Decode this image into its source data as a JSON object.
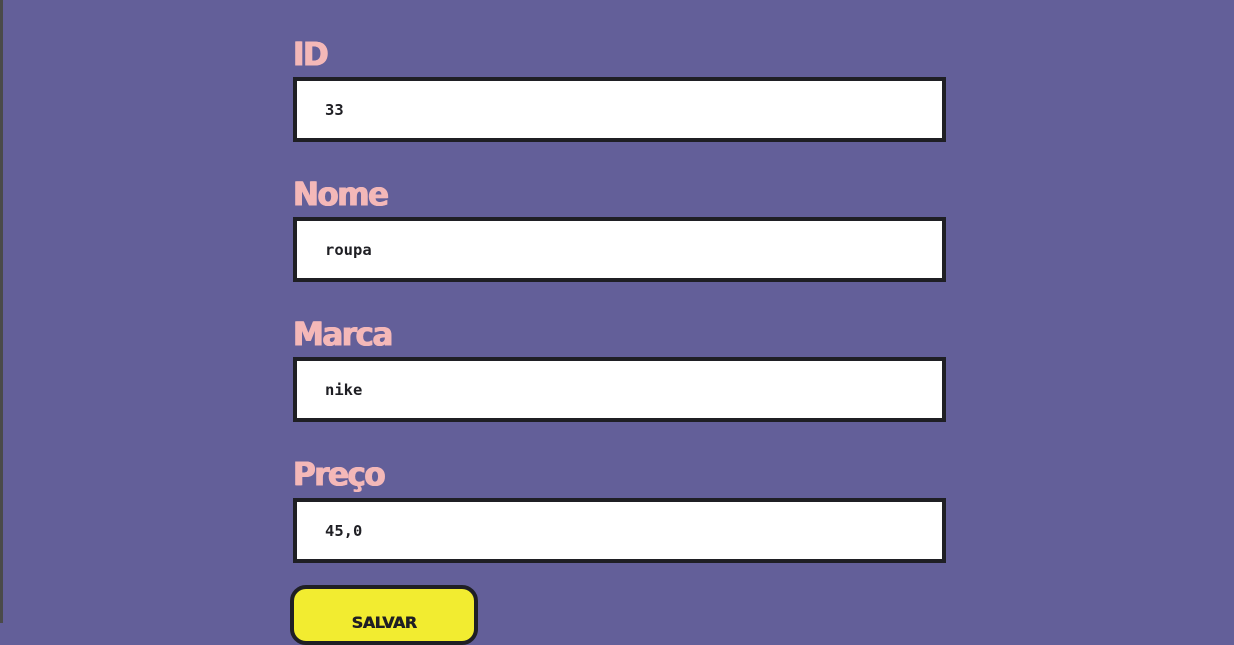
{
  "form": {
    "fields": [
      {
        "label": "ID",
        "value": "33"
      },
      {
        "label": "Nome",
        "value": "roupa"
      },
      {
        "label": "Marca",
        "value": "nike"
      },
      {
        "label": "Preço",
        "value": "45,0"
      }
    ],
    "submit_label": "SALVAR"
  },
  "colors": {
    "background": "#635f99",
    "label": "#f4b8b8",
    "input_border": "#1f1f24",
    "button": "#f2ec30"
  }
}
